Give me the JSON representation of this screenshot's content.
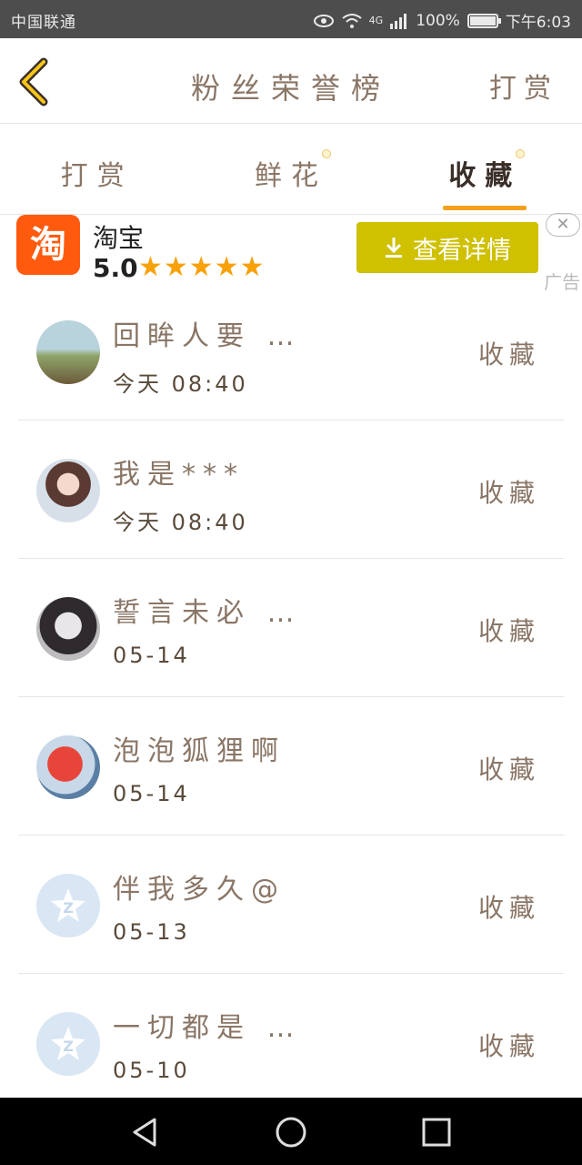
{
  "status_bar": {
    "carrier": "中国联通",
    "network": "4G",
    "battery": "100%",
    "battery_level": 1.0,
    "time": "下午6:03"
  },
  "header": {
    "title": "粉丝荣誉榜",
    "action": "打赏"
  },
  "tabs": [
    {
      "label": "打赏",
      "active": false
    },
    {
      "label": "鲜花",
      "active": false
    },
    {
      "label": "收藏",
      "active": true
    }
  ],
  "ad": {
    "logo_text": "淘",
    "app_name": "淘宝",
    "rating": "5.0",
    "stars": "★★★★★",
    "button_label": "查看详情",
    "close": "✕",
    "label": "广告"
  },
  "fans": [
    {
      "name": "回眸人要 …",
      "time": "今天 08:40",
      "type": "收藏"
    },
    {
      "name": "我是***",
      "time": "今天 08:40",
      "type": "收藏"
    },
    {
      "name": "誓言未必 …",
      "time": "05-14",
      "type": "收藏"
    },
    {
      "name": "泡泡狐狸啊",
      "time": "05-14",
      "type": "收藏"
    },
    {
      "name": "伴我多久@",
      "time": "05-13",
      "type": "收藏"
    },
    {
      "name": "一切都是 …",
      "time": "05-10",
      "type": "收藏"
    }
  ],
  "colors": {
    "accent": "#f4a01c",
    "ad_button": "#cfc000",
    "taobao": "#ff5a0e",
    "star": "#f7a10b"
  },
  "icons": [
    "back-arrow-icon",
    "eye-icon",
    "wifi-icon",
    "signal-icon",
    "battery-icon",
    "download-icon",
    "close-icon",
    "qq-default-avatar-icon",
    "nav-back-icon",
    "nav-home-icon",
    "nav-recent-icon"
  ]
}
